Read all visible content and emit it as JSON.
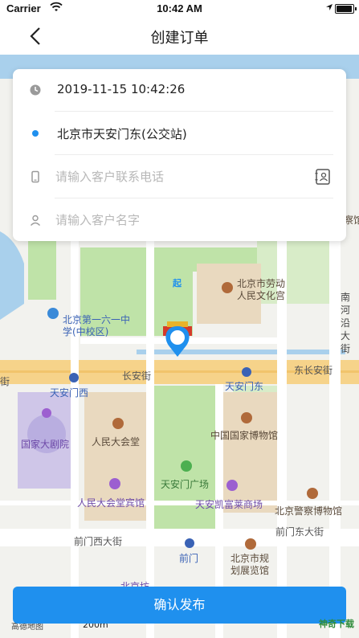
{
  "status_bar": {
    "carrier": "Carrier",
    "time": "10:42 AM"
  },
  "nav": {
    "title": "创建订单"
  },
  "form": {
    "datetime": "2019-11-15 10:42:26",
    "location": "北京市天安门东(公交站)",
    "phone_placeholder": "请输入客户联系电话",
    "name_placeholder": "请输入客户名字"
  },
  "map": {
    "pin_label": "起",
    "labels": {
      "labor_palace": "北京市劳动\n人民文化宫",
      "school": "北京第一六一中\n学(中校区)",
      "nanhe": "南\n河\n沿\n大\n街",
      "chang_an": "长安街",
      "east_chang_an": "东长安街",
      "tam_west": "天安门西",
      "tam_east": "天安门东",
      "theatre": "国家大剧院",
      "great_hall": "人民大会堂",
      "museum": "中国国家博物馆",
      "square": "天安门广场",
      "hotel": "人民大会堂宾馆",
      "kerry": "天安凯富莱商场",
      "police_museum": "北京警察博物馆",
      "qianmen_west": "前门西大街",
      "qianmen_east": "前门东大街",
      "qianmen": "前门",
      "planning": "北京市规\n划展览馆",
      "museum_side": "察馆",
      "edge_left": "街",
      "bottom_label": "北京坊",
      "amap": "高德地图",
      "scale": "200m"
    }
  },
  "confirm_label": "确认发布",
  "watermark": "神奇下载"
}
